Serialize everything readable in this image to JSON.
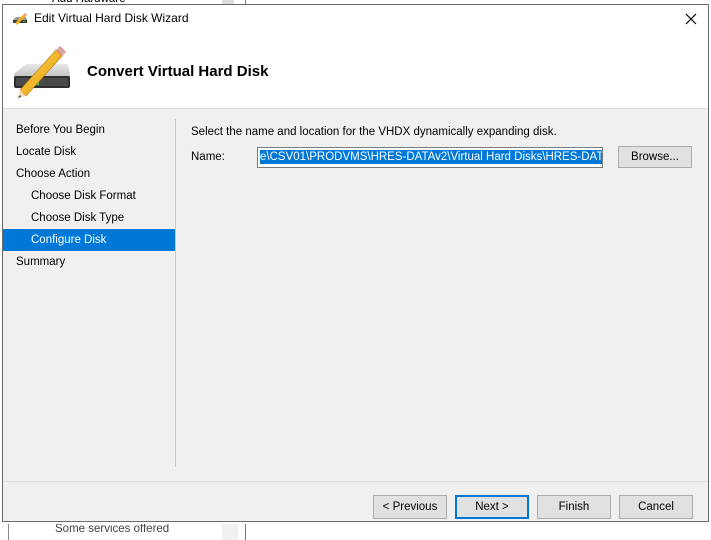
{
  "window": {
    "title": "Edit Virtual Hard Disk Wizard",
    "close_icon": "close-icon",
    "app_icon": "disk-pencil-icon"
  },
  "header": {
    "title": "Convert Virtual Hard Disk",
    "icon": "disk-pencil-icon"
  },
  "nav": {
    "items": [
      {
        "label": "Before You Begin",
        "level": 0,
        "active": false
      },
      {
        "label": "Locate Disk",
        "level": 0,
        "active": false
      },
      {
        "label": "Choose Action",
        "level": 0,
        "active": false
      },
      {
        "label": "Choose Disk Format",
        "level": 1,
        "active": false
      },
      {
        "label": "Choose Disk Type",
        "level": 1,
        "active": false
      },
      {
        "label": "Configure Disk",
        "level": 1,
        "active": true
      },
      {
        "label": "Summary",
        "level": 0,
        "active": false
      }
    ]
  },
  "content": {
    "instruction": "Select the name and location for the VHDX dynamically expanding disk.",
    "name_label": "Name:",
    "name_value_visible": "e\\CSV01\\PRODVMS\\HRES-DATAv2\\Virtual Hard Disks\\HRES-DATA-C.vhdx",
    "browse_label": "Browse..."
  },
  "footer": {
    "previous_label": "< Previous",
    "next_label": "Next >",
    "finish_label": "Finish",
    "cancel_label": "Cancel"
  },
  "background": {
    "top_text": "Add Hardware",
    "bottom_text": "Some services offered"
  },
  "colors": {
    "accent": "#0078d7",
    "dialog_bg": "#f0f0f0",
    "header_bg": "#ffffff"
  }
}
